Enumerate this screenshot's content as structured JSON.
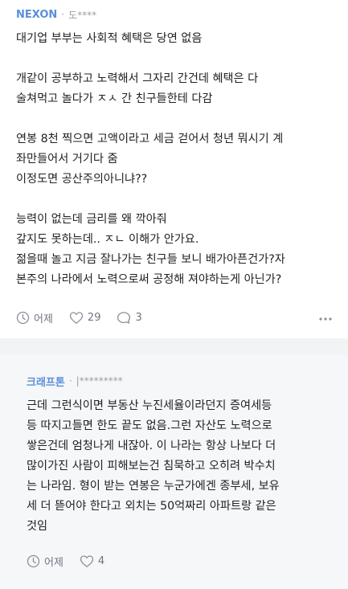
{
  "post": {
    "company": "NEXON",
    "separator": "·",
    "author": "도****",
    "lines": [
      "대기업 부부는 사회적 혜택은 당연 없음",
      "",
      "개같이 공부하고 노력해서 그자리 간건데 혜택은 다",
      "술쳐먹고 놀다가 ㅈㅅ 간 친구들한테 다감",
      "",
      "연봉 8천 찍으면 고액이라고 세금 걷어서 청년 뭐시기 계",
      "좌만들어서 거기다 줌",
      "이정도면 공산주의아니냐??",
      "",
      "능력이 없는데 금리를 왜 깍아줘",
      "갚지도 못하는데.. ㅈㄴ 이해가 안가요.",
      "젊을때 놀고 지금 잘나가는 친구들 보니 배가아픈건가?자",
      "본주의 나라에서 노력으로써 공정해 져야하는게 아닌가?"
    ],
    "time": "어제",
    "likes": "29",
    "comments": "3"
  },
  "reply": {
    "company": "크래프톤",
    "separator": "·",
    "author": "|*********",
    "lines": [
      "근데 그런식이면 부동산 누진세율이라던지 증여세등",
      "등 따지고들면 한도 끝도 없음.그런 자산도 노력으로",
      "쌓은건데 엄청나게 내잖아. 이 나라는 항상 나보다 더",
      "많이가진 사람이 피해보는건 침묵하고 오히려 박수치",
      "는 나라임. 형이 받는 연봉은 누군가에겐 종부세, 보유",
      "세 더 뜯어야 한다고 외치는 50억짜리 아파트랑 같은",
      "것임"
    ],
    "time": "어제",
    "likes": "4"
  },
  "colors": {
    "company": "#5b8fd9",
    "meta": "#9aa0a8",
    "text": "#222222",
    "reply_bg": "#f6f7f9",
    "divider_bg": "#f2f3f5"
  },
  "icons": [
    "clock-icon",
    "heart-icon",
    "comment-icon",
    "more-icon"
  ]
}
